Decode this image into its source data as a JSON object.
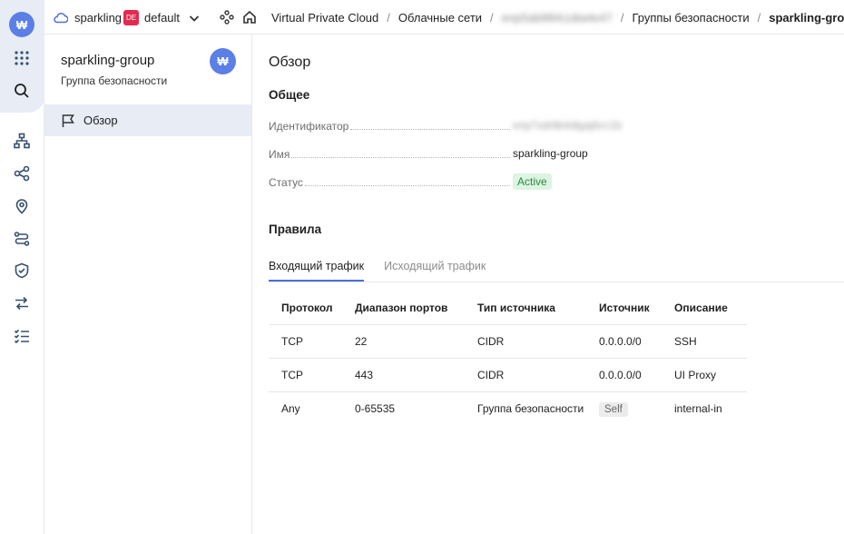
{
  "brand": {
    "logo_glyph": "₩",
    "accent": "#5b7fe6"
  },
  "topbar": {
    "cloud_name": "sparkling",
    "region_badge": "DE",
    "folder": "default",
    "breadcrumbs": [
      "Virtual Private Cloud",
      "Облачные сети",
      "enp5ab98rk1dia4e47",
      "Группы безопасности",
      "sparkling-group"
    ]
  },
  "panel": {
    "title": "sparkling-group",
    "subtitle": "Группа безопасности",
    "avatar_glyph": "₩",
    "nav": [
      {
        "label": "Обзор",
        "icon": "flag-icon",
        "active": true
      }
    ]
  },
  "main": {
    "title": "Обзор",
    "general_title": "Общее",
    "props": {
      "id_label": "Идентификатор",
      "id_value": "enp7sdr8k4dlgaj6cc1b",
      "name_label": "Имя",
      "name_value": "sparkling-group",
      "status_label": "Статус",
      "status_value": "Active"
    },
    "rules_title": "Правила",
    "tabs": [
      "Входящий трафик",
      "Исходящий трафик"
    ],
    "table": {
      "headers": [
        "Протокол",
        "Диапазон портов",
        "Тип источника",
        "Источник",
        "Описание"
      ],
      "rows": [
        [
          "TCP",
          "22",
          "CIDR",
          "0.0.0.0/0",
          "SSH"
        ],
        [
          "TCP",
          "443",
          "CIDR",
          "0.0.0.0/0",
          "UI Proxy"
        ],
        [
          "Any",
          "0-65535",
          "Группа безопасности",
          "Self",
          "internal-in"
        ]
      ]
    }
  },
  "colors": {
    "status_bg": "#dcf4e2",
    "status_fg": "#2b8a3e",
    "active_bg": "#e7ecf5",
    "tab_underline": "#4a6fd8"
  }
}
